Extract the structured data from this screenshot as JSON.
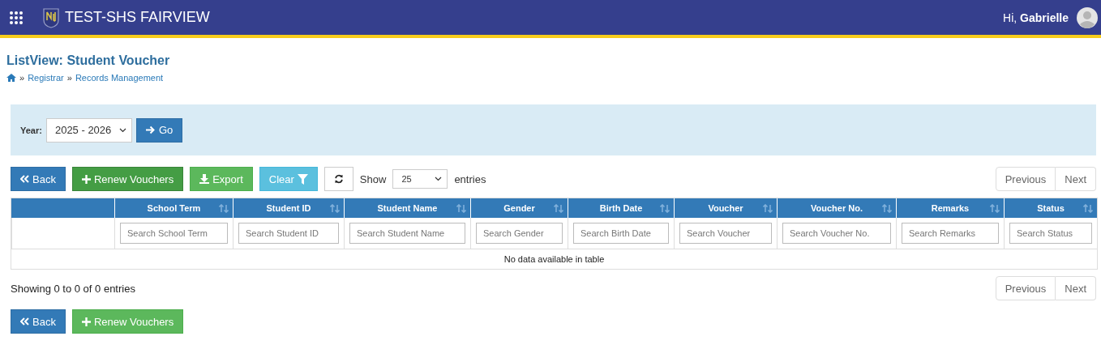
{
  "header": {
    "app_title": "TEST-SHS FAIRVIEW",
    "greeting": "Hi, **Gabrielle**"
  },
  "page": {
    "title": "ListView: Student Voucher",
    "breadcrumb": [
      {
        "prefix": "»",
        "label": "Registrar"
      },
      {
        "prefix": "»",
        "label": "Records Management"
      }
    ]
  },
  "filter": {
    "label": "Year:",
    "value": "2025 - 2026",
    "button": "Go"
  },
  "toolbar": [
    {
      "kind": "back",
      "label": "Back",
      "hovered": false
    },
    {
      "kind": "renew",
      "label": "Renew Vouchers",
      "hovered": true
    },
    {
      "kind": "export",
      "label": "Export",
      "hovered": false
    },
    {
      "kind": "clear",
      "label": "Clear",
      "hovered": false
    },
    {
      "kind": "refresh",
      "hovered": false
    }
  ],
  "length": {
    "prefix": "Show",
    "value": "25",
    "suffix": "entries"
  },
  "pagination_top": [
    "Previous",
    "Next"
  ],
  "table": {
    "columns": [
      {
        "kind": "blank"
      },
      {
        "kind": "sortable",
        "heading": "School Term",
        "placeholder": "Search School Term"
      },
      {
        "kind": "sortable",
        "heading": "Student ID",
        "placeholder": "Search Student ID"
      },
      {
        "kind": "sortable",
        "heading": "Student Name",
        "placeholder": "Search Student Name"
      },
      {
        "kind": "sortable",
        "heading": "Gender",
        "placeholder": "Search Gender"
      },
      {
        "kind": "sortable",
        "heading": "Birth Date",
        "placeholder": "Search Birth Date"
      },
      {
        "kind": "sortable",
        "heading": "Voucher",
        "placeholder": "Search Voucher"
      },
      {
        "kind": "sortable",
        "heading": "Voucher No.",
        "placeholder": "Search Voucher No."
      },
      {
        "kind": "sortable",
        "heading": "Remarks",
        "placeholder": "Search Remarks"
      },
      {
        "kind": "sortable",
        "heading": "Status",
        "placeholder": "Search Status"
      }
    ],
    "empty_message": "No data available in table"
  },
  "info": "Showing 0 to 0 of 0 entries",
  "pagination_bottom": [
    "Previous",
    "Next"
  ],
  "bottom_buttons": [
    {
      "kind": "back",
      "label": "Back",
      "hovered": false
    },
    {
      "kind": "renew",
      "label": "Renew Vouchers",
      "hovered": false
    }
  ]
}
